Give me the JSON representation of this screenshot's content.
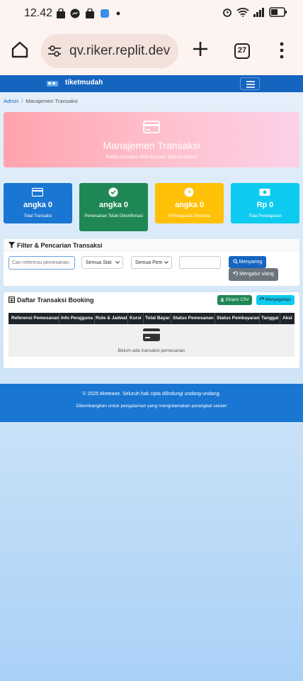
{
  "status_bar": {
    "time": "12.42"
  },
  "browser": {
    "url": "qv.riker.replit.dev",
    "tab_count": "27"
  },
  "navbar": {
    "brand": "tiketmudah"
  },
  "breadcrumb": {
    "root": "Admin",
    "current": "Manajemen Transaksi"
  },
  "hero": {
    "title": "Manajemen Transaksi",
    "subtitle": "Kelola transaksi tiket bus dari aplikasi utama"
  },
  "stats": [
    {
      "value": "angka 0",
      "label": "Total Transaksi",
      "color": "#1976d2"
    },
    {
      "value": "angka 0",
      "label": "Pemesanan Telah Dikonfirmasi",
      "color": "#1e8754"
    },
    {
      "value": "angka 0",
      "label": "Pembayaran Tertunda",
      "color": "#ffc107"
    },
    {
      "value": "Rp 0",
      "label": "Total Pendapatan",
      "color": "#0dcaf0"
    }
  ],
  "filter": {
    "title": "Filter & Pencarian Transaksi",
    "search_placeholder": "Cari referensi pemesanan,",
    "status_select": "Semua Stat",
    "payment_select": "Semua Pem",
    "search_button": "Menyaring",
    "reset_button": "Mengatur ulang"
  },
  "table": {
    "title": "Daftar Transaksi Booking",
    "export_button": "Ekspor CSV",
    "refresh_button": "Menyegarkan",
    "columns": [
      "Referensi Pemesanan",
      "Info Pengguna",
      "Rute & Jadwal",
      "Kursi",
      "Total Bayar",
      "Status Pemesanan",
      "Status Pembayaran",
      "Tanggal",
      "Aksi"
    ],
    "empty_text": "Belum ada transaksi pemesanan"
  },
  "footer": {
    "copyright": "© 2025 tiketease. Seluruh hak cipta dilindungi undang-undang.",
    "tagline": "Dikembangkan untuk pengalaman yang mengutamakan perangkat seluler"
  }
}
